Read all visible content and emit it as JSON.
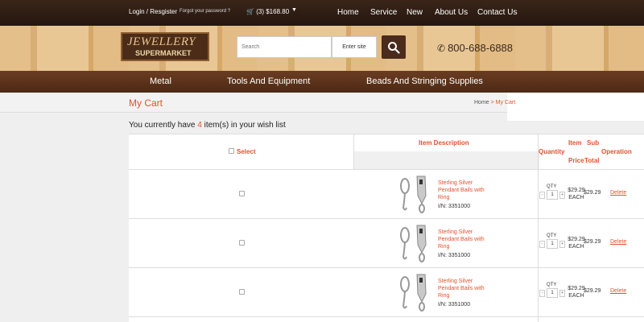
{
  "topbar": {
    "login": "Login / Resgister",
    "forgot": "Forgot your password ?",
    "cart_total": "(3) $168.80",
    "nav": [
      "Home",
      "Service",
      "New",
      "About Us",
      "Contact Us"
    ]
  },
  "header": {
    "logo_line1": "JEWELLERY",
    "logo_line2": "SUPERMARKET",
    "search_placeholder": "Search",
    "site_button": "Enter site",
    "phone": "800-688-6888"
  },
  "categories": [
    "Metal",
    "Tools And Equipment",
    "Beads And Stringing Supplies"
  ],
  "page": {
    "title": "My Cart",
    "breadcrumb_home": "Home",
    "breadcrumb_sep": " > ",
    "breadcrumb_current": "My Cart",
    "summary_pre": "You currently have ",
    "summary_count": "4",
    "summary_post": " item(s) in your wish list"
  },
  "table": {
    "headers": {
      "select": "Select",
      "description": "Item Description",
      "quantity": "Quantity",
      "item_price_top": "Item",
      "item_price_bottom": "Price",
      "subtotal_top": "Sub",
      "subtotal_bottom": "Total",
      "operation": "Operation"
    },
    "rows": [
      {
        "name": "Sterling Silver Pendant Bails with Ring",
        "item_no": "I/N: 3351000",
        "qty_label": "QTY",
        "qty": "1",
        "price": "$29.29",
        "unit": "EACH",
        "subtotal": "$29.29",
        "action": "Delete"
      },
      {
        "name": "Sterling Silver Pendant Bails with Ring",
        "item_no": "I/N: 3351000",
        "qty_label": "QTY",
        "qty": "1",
        "price": "$29.29",
        "unit": "EACH",
        "subtotal": "$29.29",
        "action": "Delete"
      },
      {
        "name": "Sterling Silver Pendant Bails with Ring",
        "item_no": "I/N: 3351000",
        "qty_label": "QTY",
        "qty": "1",
        "price": "$29.29",
        "unit": "EACH",
        "subtotal": "$29.29",
        "action": "Delete"
      }
    ]
  },
  "colors": {
    "accent": "#e0532e",
    "topbar": "#2a1a12",
    "catbar": "#5a321b"
  }
}
